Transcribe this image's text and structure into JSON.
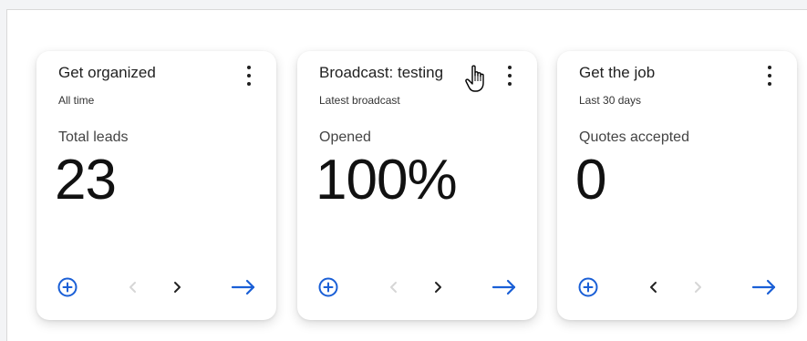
{
  "colors": {
    "accent": "#1a5fd6",
    "text": "#222222",
    "disabled": "#d6d6d6",
    "enabled_nav": "#222222"
  },
  "cards": [
    {
      "title": "Get organized",
      "subtitle": "All time",
      "metric_label": "Total leads",
      "metric_value": "23",
      "prev_enabled": false,
      "next_enabled": true
    },
    {
      "title": "Broadcast: testing",
      "subtitle": "Latest broadcast",
      "metric_label": "Opened",
      "metric_value": "100%",
      "prev_enabled": false,
      "next_enabled": true
    },
    {
      "title": "Get the job",
      "subtitle": "Last 30 days",
      "metric_label": "Quotes accepted",
      "metric_value": "0",
      "prev_enabled": true,
      "next_enabled": false
    }
  ],
  "icons": {
    "menu": "more-vertical-icon",
    "add": "plus-circle-icon",
    "prev": "chevron-left-icon",
    "next": "chevron-right-icon",
    "go": "arrow-right-icon",
    "cursor": "hand-pointer-icon"
  }
}
